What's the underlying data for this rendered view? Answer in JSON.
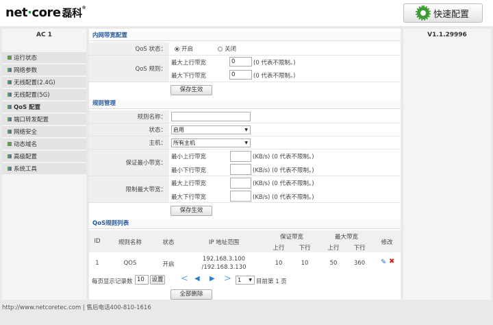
{
  "header": {
    "logo_main": "net",
    "logo_dot": "·",
    "logo_end": "core",
    "logo_cn": "磊科",
    "logo_reg": "®",
    "quick_config": "快速配置"
  },
  "left": {
    "ac_label": "AC 1",
    "menu": [
      "运行状态",
      "网络参数",
      "无线配置(2.4G)",
      "无线配置(5G)",
      "QoS 配置",
      "端口转发配置",
      "网络安全",
      "动态域名",
      "高级配置",
      "系统工具"
    ]
  },
  "right": {
    "version": "V1.1.29996"
  },
  "bandwidth": {
    "title": "内网带宽配置",
    "qos_state_label": "QoS 状态：",
    "on": "开启",
    "off": "关闭",
    "qos_rule_label": "QoS 规则：",
    "max_up": "最大上行带宽",
    "max_down": "最大下行带宽",
    "up_value": "0",
    "down_value": "0",
    "hint": "(0 代表不限制。)",
    "save": "保存生效"
  },
  "rules": {
    "title": "规则管理",
    "name_label": "规则名称：",
    "name_value": "",
    "state_label": "状态：",
    "state_value": "启用",
    "host_label": "主机：",
    "host_value": "所有主机",
    "min_label": "保证最小带宽：",
    "min_up": "最小上行带宽",
    "min_down": "最小下行带宽",
    "max_label": "限制最大带宽：",
    "max_up": "最大上行带宽",
    "max_down": "最大下行带宽",
    "hint": "(KB/s) (0 代表不限制。)",
    "save": "保存生效"
  },
  "list": {
    "title": "QoS规则列表",
    "headers": {
      "id": "ID",
      "name": "规则名称",
      "state": "状态",
      "ip": "IP 地址范围",
      "guaranteed": "保证带宽",
      "max": "最大带宽",
      "up": "上行",
      "down": "下行",
      "edit": "修改"
    },
    "rows": [
      {
        "id": "1",
        "name": "QOS",
        "state": "开启",
        "ip1": "192.168.3.100",
        "ip2": "/192.168.3.130",
        "g_up": "10",
        "g_down": "10",
        "m_up": "50",
        "m_down": "360"
      }
    ],
    "per_page_label": "每页显示记录数",
    "per_page_value": "10",
    "set": "设置",
    "page_value": "1",
    "current_page": "目前第 1 页",
    "delete_all": "全部删除"
  },
  "footer": {
    "text": "http://www.netcoretec.com | 售后电话400-810-1616"
  }
}
